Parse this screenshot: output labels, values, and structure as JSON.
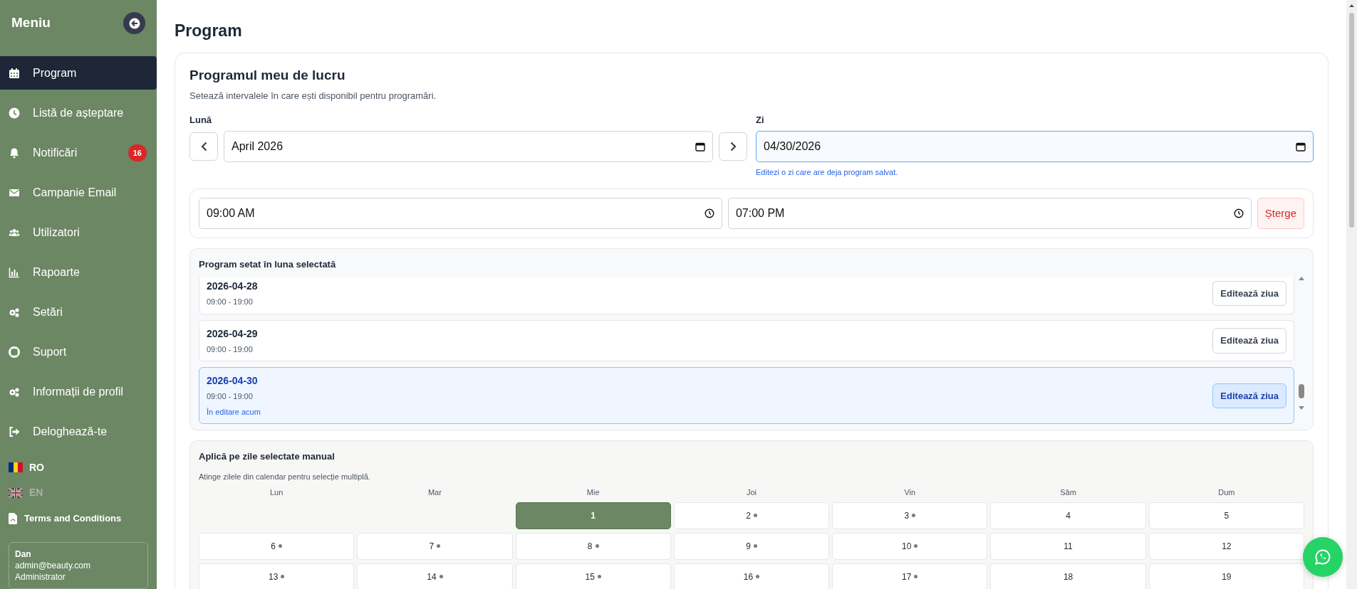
{
  "sidebar": {
    "title": "Meniu",
    "items": [
      {
        "label": "Program",
        "selected": true
      },
      {
        "label": "Listă de așteptare",
        "selected": false
      },
      {
        "label": "Notificări",
        "selected": false,
        "badge": "16"
      },
      {
        "label": "Campanie Email",
        "selected": false
      },
      {
        "label": "Utilizatori",
        "selected": false
      },
      {
        "label": "Rapoarte",
        "selected": false
      },
      {
        "label": "Setări",
        "selected": false
      },
      {
        "label": "Suport",
        "selected": false
      },
      {
        "label": "Informații de profil",
        "selected": false
      },
      {
        "label": "Deloghează-te",
        "selected": false
      }
    ],
    "languages": [
      {
        "code": "RO",
        "selected": true
      },
      {
        "code": "EN",
        "selected": false
      }
    ],
    "terms_link": "Terms and Conditions",
    "user": {
      "name": "Dan",
      "email": "admin@beauty.com",
      "role": "Administrator"
    }
  },
  "page_title": "Program",
  "schedule_card": {
    "title": "Programul meu de lucru",
    "subtitle": "Setează intervalele în care ești disponibil pentru programări.",
    "month": {
      "label": "Lună",
      "value": "April 2026"
    },
    "day": {
      "label": "Zi",
      "value": "04/30/2026",
      "focused": true,
      "hint": "Editezi o zi care are deja program salvat."
    },
    "interval": {
      "start": "09:00 AM",
      "end": "07:00 PM",
      "delete_button": "Șterge"
    },
    "month_schedule": {
      "title": "Program setat în luna selectată",
      "rows": [
        {
          "date": "2026-04-28",
          "hours": "09:00 - 19:00",
          "selected": false,
          "button": "Editează ziua"
        },
        {
          "date": "2026-04-29",
          "hours": "09:00 - 19:00",
          "selected": false,
          "button": "Editează ziua"
        },
        {
          "date": "2026-04-30",
          "hours": "09:00 - 19:00",
          "selected": true,
          "note": "În editare acum",
          "button": "Editează ziua"
        }
      ]
    },
    "manual_days": {
      "title": "Aplică pe zile selectate manual",
      "hint": "Atinge zilele din calendar pentru selecție multiplă.",
      "weekdays": [
        "Lun",
        "Mar",
        "Mie",
        "Joi",
        "Vin",
        "Sâm",
        "Dum"
      ],
      "days": [
        {
          "kind": "empty"
        },
        {
          "kind": "empty"
        },
        {
          "kind": "day",
          "label": "1",
          "selected": true,
          "has_schedule": false
        },
        {
          "kind": "day",
          "label": "2",
          "selected": false,
          "has_schedule": true
        },
        {
          "kind": "day",
          "label": "3",
          "selected": false,
          "has_schedule": true
        },
        {
          "kind": "day",
          "label": "4",
          "selected": false,
          "has_schedule": false
        },
        {
          "kind": "day",
          "label": "5",
          "selected": false,
          "has_schedule": false
        },
        {
          "kind": "day",
          "label": "6",
          "selected": false,
          "has_schedule": true
        },
        {
          "kind": "day",
          "label": "7",
          "selected": false,
          "has_schedule": true
        },
        {
          "kind": "day",
          "label": "8",
          "selected": false,
          "has_schedule": true
        },
        {
          "kind": "day",
          "label": "9",
          "selected": false,
          "has_schedule": true
        },
        {
          "kind": "day",
          "label": "10",
          "selected": false,
          "has_schedule": true
        },
        {
          "kind": "day",
          "label": "11",
          "selected": false,
          "has_schedule": false
        },
        {
          "kind": "day",
          "label": "12",
          "selected": false,
          "has_schedule": false
        },
        {
          "kind": "day",
          "label": "13",
          "selected": false,
          "has_schedule": true
        },
        {
          "kind": "day",
          "label": "14",
          "selected": false,
          "has_schedule": true
        },
        {
          "kind": "day",
          "label": "15",
          "selected": false,
          "has_schedule": true
        },
        {
          "kind": "day",
          "label": "16",
          "selected": false,
          "has_schedule": true
        },
        {
          "kind": "day",
          "label": "17",
          "selected": false,
          "has_schedule": true
        },
        {
          "kind": "day",
          "label": "18",
          "selected": false,
          "has_schedule": false
        },
        {
          "kind": "day",
          "label": "19",
          "selected": false,
          "has_schedule": false
        }
      ]
    }
  }
}
